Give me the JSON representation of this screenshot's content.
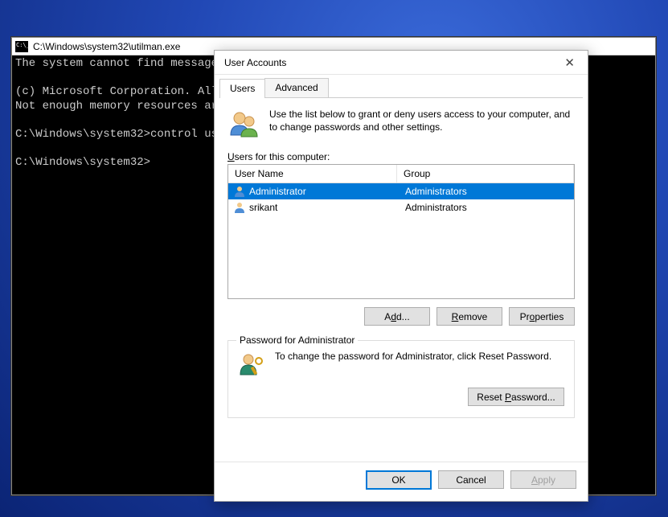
{
  "cmd": {
    "title": "C:\\Windows\\system32\\utilman.exe",
    "lines": "The system cannot find message                                          pplication.\n\n(c) Microsoft Corporation. All\nNot enough memory resources ar\n\nC:\\Windows\\system32>control us\n\nC:\\Windows\\system32>"
  },
  "ua": {
    "title": "User Accounts",
    "tabs": {
      "users": "Users",
      "advanced": "Advanced"
    },
    "intro_text": "Use the list below to grant or deny users access to your computer, and to change passwords and other settings.",
    "list_label_pre": "U",
    "list_label_post": "sers for this computer:",
    "cols": {
      "user": "User Name",
      "group": "Group"
    },
    "rows": [
      {
        "name": "Administrator",
        "group": "Administrators",
        "selected": true
      },
      {
        "name": "srikant",
        "group": "Administrators",
        "selected": false
      }
    ],
    "buttons": {
      "add": "Add...",
      "remove": "Remove",
      "properties": "Properties",
      "ok": "OK",
      "cancel": "Cancel",
      "apply": "Apply",
      "reset_password": "Reset Password..."
    },
    "hotkeys": {
      "add": "d",
      "remove": "R",
      "properties": "o",
      "reset": "P",
      "apply": "A"
    },
    "group_title": "Password for Administrator",
    "group_text": "To change the password for Administrator, click Reset Password."
  }
}
